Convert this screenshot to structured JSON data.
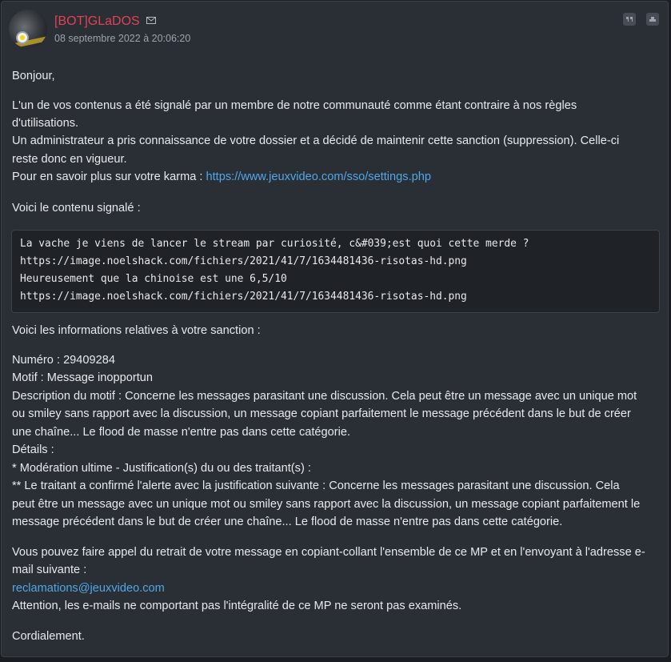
{
  "post": {
    "author": "[BOT]GLaDOS",
    "date": "08 septembre 2022 à 20:06:20"
  },
  "icons": {
    "mail": "mail-icon",
    "quote": "quote-icon",
    "alert": "alert-icon"
  },
  "message": {
    "greeting": "Bonjour,",
    "p1_line1": "L'un de vos contenus a été signalé par un membre de notre communauté comme étant contraire à nos règles",
    "p1_line2": "d'utilisations.",
    "p1_line3": "Un administrateur a pris connaissance de votre dossier et a décidé de maintenir cette sanction (suppression). Celle-ci",
    "p1_line4": "reste donc en vigueur.",
    "karma_text": "Pour en savoir plus sur votre karma : ",
    "karma_link": "https://www.jeuxvideo.com/sso/settings.php",
    "reported_heading": "Voici le contenu signalé :",
    "code_lines": [
      "La vache je viens de lancer le stream par curiosité, c&#039;est quoi cette merde ?",
      "https://image.noelshack.com/fichiers/2021/41/7/1634481436-risotas-hd.png",
      "Heureusement que la chinoise est une 6,5/10",
      "https://image.noelshack.com/fichiers/2021/41/7/1634481436-risotas-hd.png"
    ],
    "sanction_heading": "Voici les informations relatives à votre sanction :",
    "numero": "Numéro : 29409284",
    "motif": "Motif : Message inopportun",
    "desc_line1": "Description du motif : Concerne les messages parasitant une discussion. Cela peut être un message avec un unique mot",
    "desc_line2": "ou smiley sans rapport avec la discussion, un message copiant parfaitement le message précédent dans le but de créer",
    "desc_line3": "une chaîne... Le flood de masse n'entre pas dans cette catégorie.",
    "details": "Détails :",
    "detail_1": "* Modération ultime - Justification(s) du ou des traitant(s) :",
    "detail_2_line1": "** Le traitant a confirmé l'alerte avec la justification suivante : Concerne les messages parasitant une discussion. Cela",
    "detail_2_line2": "peut être un message avec un unique mot ou smiley sans rapport avec la discussion, un message copiant parfaitement le",
    "detail_2_line3": "message précédent dans le but de créer une chaîne... Le flood de masse n'entre pas dans cette catégorie.",
    "appeal_line1": "Vous pouvez faire appel du retrait de votre message en copiant-collant l'ensemble de ce MP et en l'envoyant à l'adresse e-",
    "appeal_line2": "mail suivante :",
    "email": "reclamations@jeuxvideo.com",
    "warning": "Attention, les e-mails ne comportant pas l'intégralité de ce MP ne seront pas examinés.",
    "closing": "Cordialement."
  }
}
